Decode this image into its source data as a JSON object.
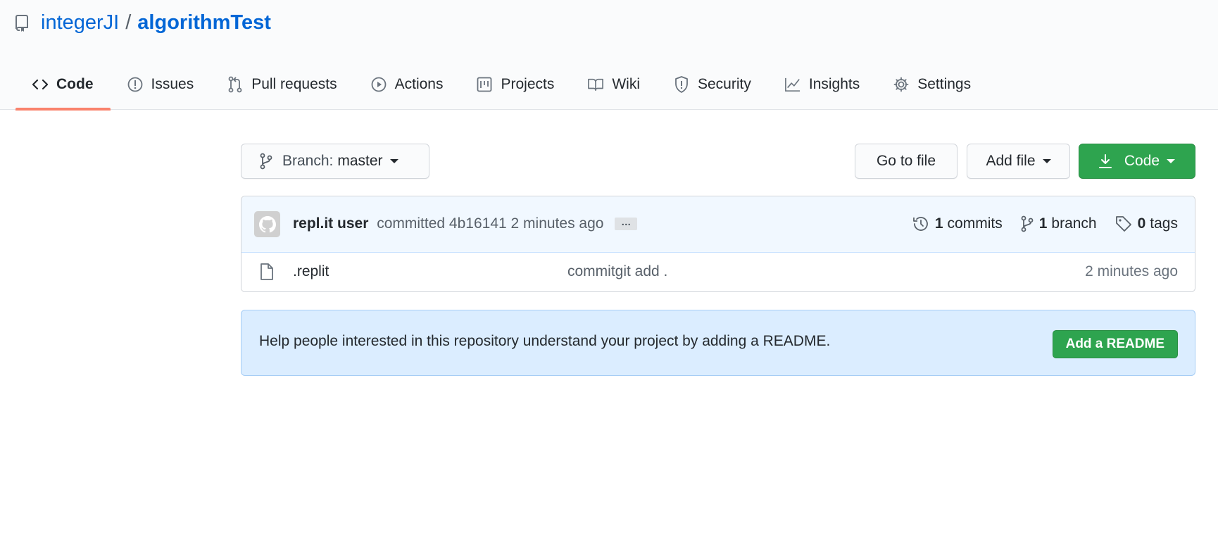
{
  "repo": {
    "owner": "integerJI",
    "separator": "/",
    "name": "algorithmTest"
  },
  "tabs": [
    {
      "label": "Code",
      "icon": "code-icon",
      "selected": true
    },
    {
      "label": "Issues",
      "icon": "issue-icon"
    },
    {
      "label": "Pull requests",
      "icon": "pull-request-icon"
    },
    {
      "label": "Actions",
      "icon": "play-icon"
    },
    {
      "label": "Projects",
      "icon": "project-icon"
    },
    {
      "label": "Wiki",
      "icon": "book-icon"
    },
    {
      "label": "Security",
      "icon": "shield-icon"
    },
    {
      "label": "Insights",
      "icon": "graph-icon"
    },
    {
      "label": "Settings",
      "icon": "gear-icon"
    }
  ],
  "toolbar": {
    "branch_prefix": "Branch:",
    "branch_name": "master",
    "go_to_file": "Go to file",
    "add_file": "Add file",
    "code": "Code"
  },
  "commit": {
    "author": "repl.it user",
    "action": "committed",
    "sha": "4b16141",
    "time": "2 minutes ago",
    "ellipsis": "…",
    "commits_count": "1",
    "commits_label": "commits",
    "branch_count": "1",
    "branch_label": "branch",
    "tags_count": "0",
    "tags_label": "tags"
  },
  "files": [
    {
      "name": ".replit",
      "message": "commitgit add .",
      "age": "2 minutes ago"
    }
  ],
  "readme": {
    "message": "Help people interested in this repository understand your project by adding a README.",
    "button": "Add a README"
  },
  "colors": {
    "link": "#0366d6",
    "tab_underline": "#f9826c",
    "primary_green": "#2ea44f",
    "commit_bar_bg": "#f1f8ff",
    "readme_bg": "#dbedff"
  }
}
